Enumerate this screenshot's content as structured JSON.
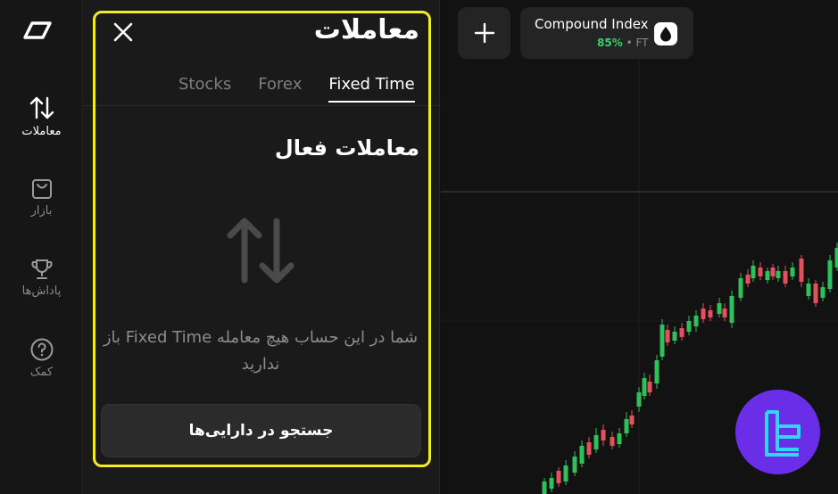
{
  "rail": {
    "items": [
      {
        "label": "معاملات",
        "icon": "arrows-up-down-icon",
        "active": true
      },
      {
        "label": "بازار",
        "icon": "shopping-bag-icon",
        "active": false
      },
      {
        "label": "پاداش‌ها",
        "icon": "trophy-icon",
        "active": false
      },
      {
        "label": "کمک",
        "icon": "help-circle-icon",
        "active": false
      }
    ]
  },
  "panel": {
    "title": "معاملات",
    "tabs": [
      {
        "label": "Stocks",
        "active": false
      },
      {
        "label": "Forex",
        "active": false
      },
      {
        "label": "Fixed Time",
        "active": true
      }
    ],
    "section_title": "معاملات فعال",
    "empty_message": "شما در این حساب هیچ معامله Fixed Time باز ندارید",
    "search_button": "جستجو در دارایی‌ها",
    "highlight_color": "#f2ec23"
  },
  "header": {
    "add_label": "+",
    "asset": {
      "name": "Compound Index",
      "payout": "85%",
      "type": "• FT",
      "icon": "drop-icon"
    }
  },
  "colors": {
    "bull": "#2fbf5b",
    "bear": "#e2525d",
    "brand": "#6b2ee8",
    "payout": "#37d16a"
  }
}
